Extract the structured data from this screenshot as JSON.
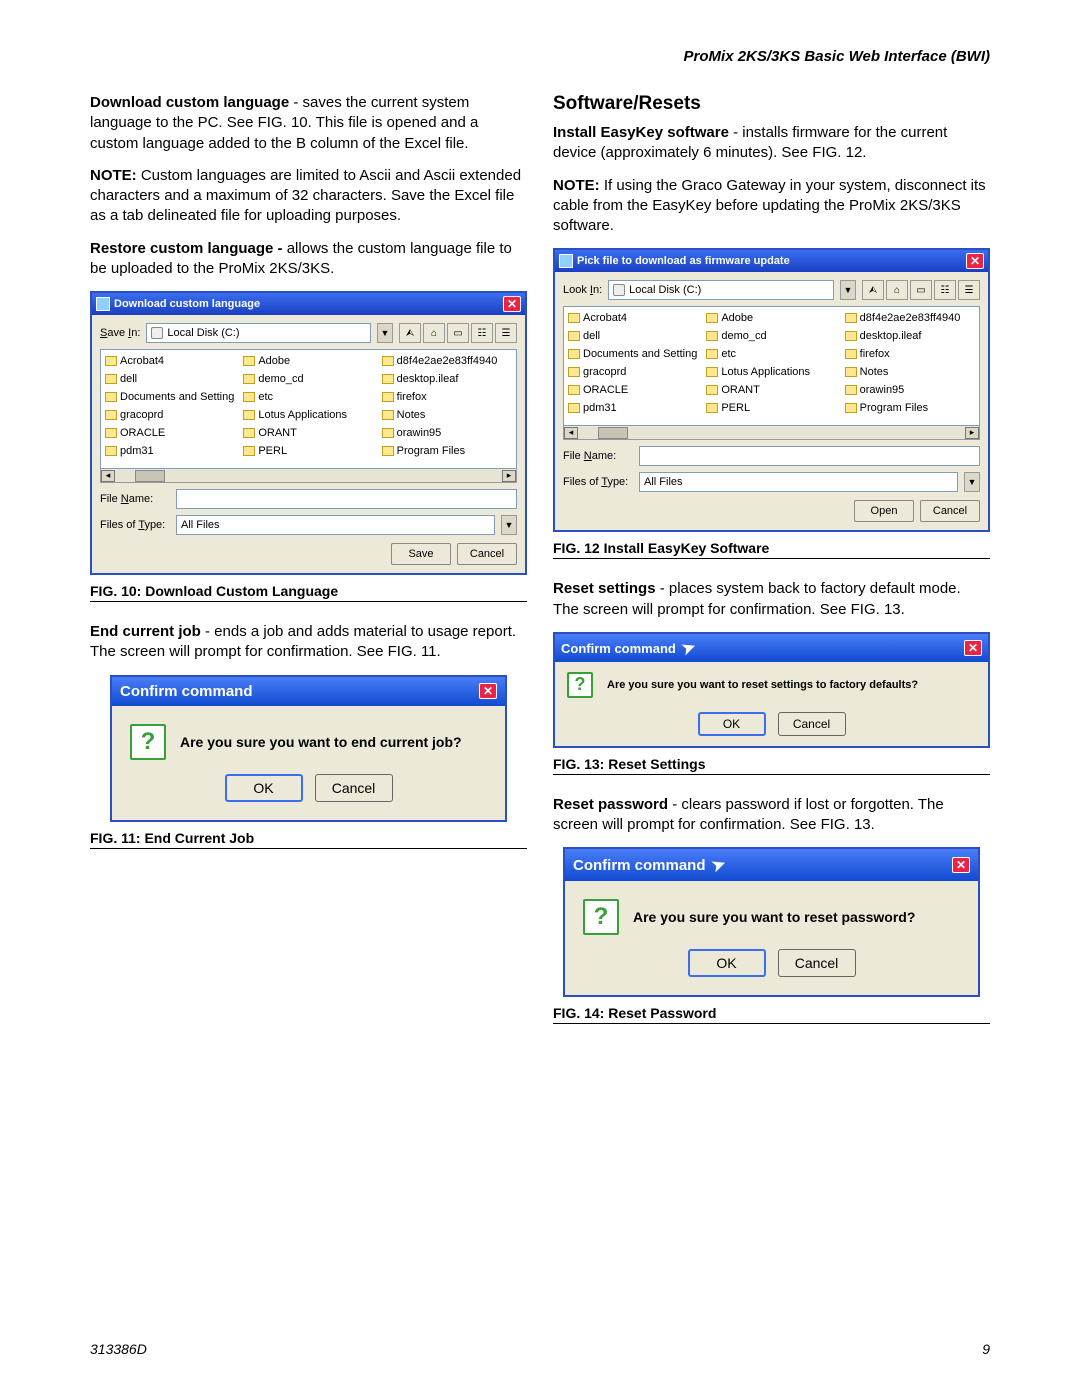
{
  "header": "ProMix 2KS/3KS Basic Web Interface (BWI)",
  "footer": {
    "left": "313386D",
    "right": "9"
  },
  "left": {
    "p1a": "Download custom language",
    "p1b": " - saves the current system language to the PC. See FIG. 10. This file is opened and a custom language added to the B column of the Excel file.",
    "p2a": "NOTE:",
    "p2b": " Custom languages are limited to Ascii and Ascii extended characters and a maximum of 32 characters. Save the Excel file as a tab delineated file for uploading purposes.",
    "p3a": "Restore custom language -",
    "p3b": " allows the custom language file to be uploaded to the ProMix 2KS/3KS.",
    "fig10": "FIG. 10: Download Custom Language",
    "p4a": "End current job",
    "p4b": " - ends a job and adds material to usage report. The screen will prompt for confirmation. See FIG. 11.",
    "fig11": "FIG. 11: End Current Job"
  },
  "right": {
    "h2": "Software/Resets",
    "p1a": "Install EasyKey software",
    "p1b": " - installs firmware for the current device (approximately 6 minutes). See FIG. 12.",
    "p2a": "NOTE:",
    "p2b": " If using the Graco Gateway in your system, disconnect its cable from the EasyKey before updating the ProMix 2KS/3KS software.",
    "fig12": "FIG. 12 Install EasyKey Software",
    "p3a": "Reset settings",
    "p3b": " - places system back to factory default mode. The screen will prompt for confirmation. See FIG. 13.",
    "fig13": "FIG. 13: Reset Settings",
    "p4a": "Reset password",
    "p4b": " - clears password if lost or forgotten. The screen will prompt for confirmation. See FIG. 13.",
    "fig14": "FIG. 14: Reset Password"
  },
  "dlg10": {
    "title": "Download custom language",
    "savein_lbl": "Save In:",
    "savein_val": "Local Disk (C:)",
    "filename_lbl": "File Name:",
    "filetype_lbl": "Files of Type:",
    "filetype_val": "All Files",
    "save": "Save",
    "cancel": "Cancel",
    "files": [
      "Acrobat4",
      "Adobe",
      "d8f4e2ae2e83ff4940",
      "dell",
      "demo_cd",
      "desktop.ileaf",
      "Documents and Settings",
      "etc",
      "firefox",
      "gracoprd",
      "Lotus Applications",
      "Notes",
      "ORACLE",
      "ORANT",
      "orawin95",
      "pdm31",
      "PERL",
      "Program Files"
    ]
  },
  "dlg12": {
    "title": "Pick file to download as firmware update",
    "lookin_lbl": "Look In:",
    "lookin_val": "Local Disk (C:)",
    "filename_lbl": "File Name:",
    "filetype_lbl": "Files of Type:",
    "filetype_val": "All Files",
    "open": "Open",
    "cancel": "Cancel",
    "files": [
      "Acrobat4",
      "Adobe",
      "d8f4e2ae2e83ff4940",
      "dell",
      "demo_cd",
      "desktop.ileaf",
      "Documents and Settings",
      "etc",
      "firefox",
      "gracoprd",
      "Lotus Applications",
      "Notes",
      "ORACLE",
      "ORANT",
      "orawin95",
      "pdm31",
      "PERL",
      "Program Files"
    ]
  },
  "confirm": {
    "title": "Confirm command",
    "ok": "OK",
    "cancel": "Cancel",
    "msg11": "Are you sure you want to end current job?",
    "msg13": "Are you sure you want to reset settings to factory defaults?",
    "msg14": "Are you sure you want to reset password?"
  }
}
